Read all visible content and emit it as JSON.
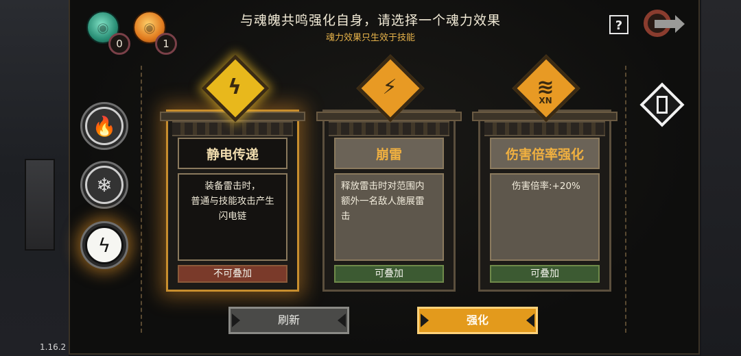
{
  "header": {
    "title": "与魂魄共鸣强化自身，请选择一个魂力效果",
    "subtitle": "魂力效果只生效于技能"
  },
  "resources": [
    {
      "name": "green-soul-orb-icon",
      "count": "0",
      "color": "#3aa88a"
    },
    {
      "name": "orange-soul-orb-icon",
      "count": "1",
      "color": "#e0861e"
    }
  ],
  "top_right": {
    "help_label": "?"
  },
  "elements": [
    {
      "name": "fire",
      "glyph": "🔥",
      "selected": false
    },
    {
      "name": "ice",
      "glyph": "❄",
      "selected": false
    },
    {
      "name": "thunder",
      "glyph": "ϟ",
      "selected": true
    }
  ],
  "cards": [
    {
      "name": "静电传递",
      "description": "装备雷击时，普通与技能攻击产生闪电链",
      "description_lines": [
        "装备雷击时，",
        "普通与技能攻击产生",
        "闪电链"
      ],
      "stack": "不可叠加",
      "selected": true,
      "emblem_glyph": "ϟ",
      "emblem_mark": ""
    },
    {
      "name": "崩雷",
      "description": "释放雷击时对范围内额外一名敌人施展雷击",
      "description_lines": [
        "释放雷击时对范围内",
        "额外一名敌人施展雷",
        "击"
      ],
      "stack": "可叠加",
      "selected": false,
      "emblem_glyph": "⚡",
      "emblem_mark": ""
    },
    {
      "name": "伤害倍率强化",
      "description": "伤害倍率:+20%",
      "description_lines": [
        "伤害倍率:+20%"
      ],
      "stack": "可叠加",
      "selected": false,
      "emblem_glyph": "≋",
      "emblem_mark": "XN"
    }
  ],
  "buttons": {
    "refresh": "刷新",
    "enhance": "强化"
  },
  "version": "1.16.2",
  "colors": {
    "accent_gold": "#e39a1c",
    "subtitle_gold": "#e6b24a",
    "stackable_green": "#3c5a32",
    "not_stackable_red": "#7a3a2a"
  }
}
